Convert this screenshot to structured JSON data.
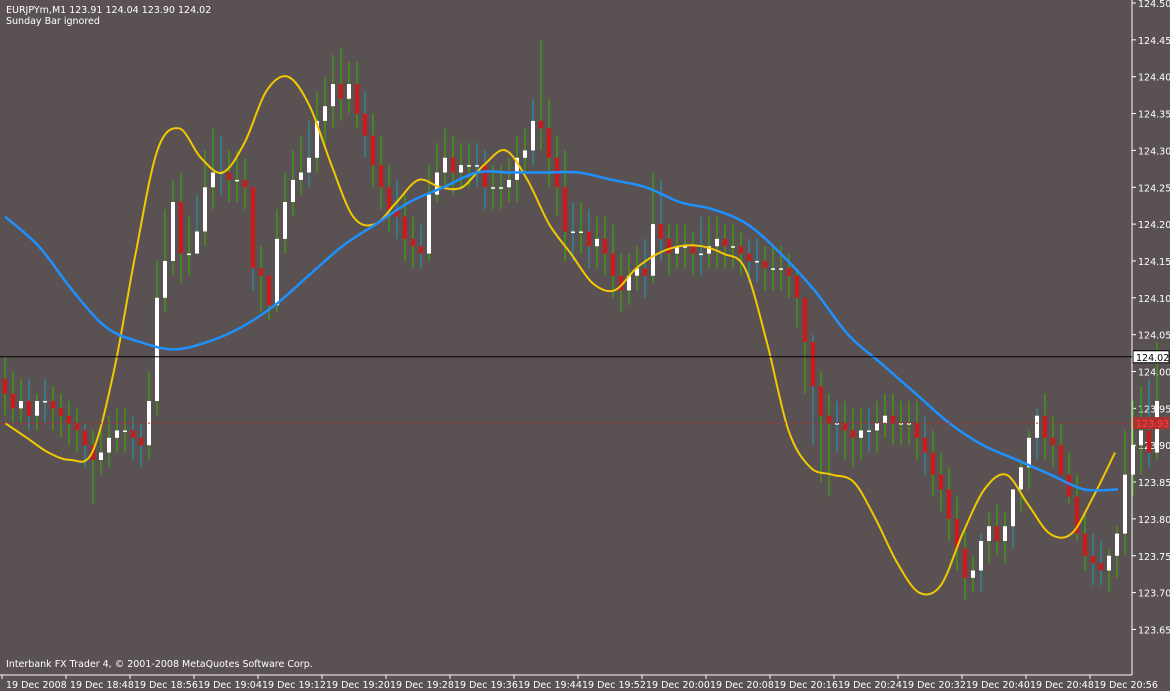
{
  "header": {
    "symbol_line": "EURJPYm,M1  123.91 124.04 123.90 124.02",
    "note": "Sunday Bar ignored"
  },
  "footer": {
    "copyright": "Interbank FX Trader 4, © 2001-2008 MetaQuotes Software Corp."
  },
  "colors": {
    "background": "#5a5252",
    "axis": "#ffffff",
    "bull_candle": "#ffffff",
    "bear_candle": "#d01818",
    "wick": "#34b400",
    "wick_alt": "#1aa0b4",
    "fast_ma": "#f2c800",
    "slow_ma": "#1e90ff",
    "bid_line": "#000000",
    "ask_line": "#b03030"
  },
  "chart_data": {
    "type": "line",
    "title": "EURJPYm,M1",
    "ylim": [
      123.6,
      124.5
    ],
    "yticks": [
      "124.50",
      "124.45",
      "124.40",
      "124.35",
      "124.30",
      "124.25",
      "124.20",
      "124.15",
      "124.10",
      "124.05",
      "124.00",
      "123.95",
      "123.90",
      "123.85",
      "123.80",
      "123.75",
      "123.70",
      "123.65"
    ],
    "xticks": [
      "19 Dec 2008",
      "19 Dec 18:48",
      "19 Dec 18:56",
      "19 Dec 19:04",
      "19 Dec 19:12",
      "19 Dec 19:20",
      "19 Dec 19:28",
      "19 Dec 19:36",
      "19 Dec 19:44",
      "19 Dec 19:52",
      "19 Dec 20:00",
      "19 Dec 20:08",
      "19 Dec 20:16",
      "19 Dec 20:24",
      "19 Dec 20:32",
      "19 Dec 20:40",
      "19 Dec 20:48",
      "19 Dec 20:56"
    ],
    "price_label": "124.02",
    "ask_label": "123.93",
    "bid_level": 124.02,
    "ask_level": 123.93,
    "candles": {
      "open": [
        123.99,
        123.97,
        123.95,
        123.96,
        123.94,
        123.96,
        123.96,
        123.95,
        123.94,
        123.93,
        123.92,
        123.9,
        123.88,
        123.89,
        123.91,
        123.92,
        123.92,
        123.91,
        123.9,
        123.96,
        124.1,
        124.15,
        124.23,
        124.16,
        124.16,
        124.19,
        124.25,
        124.27,
        124.27,
        124.26,
        124.26,
        124.25,
        124.14,
        124.13,
        124.09,
        124.18,
        124.23,
        124.26,
        124.27,
        124.29,
        124.34,
        124.36,
        124.39,
        124.37,
        124.39,
        124.35,
        124.32,
        124.28,
        124.25,
        124.22,
        124.21,
        124.18,
        124.17,
        124.16,
        124.24,
        124.27,
        124.29,
        124.27,
        124.28,
        124.28,
        124.28,
        124.25,
        124.25,
        124.25,
        124.26,
        124.29,
        124.3,
        124.34,
        124.33,
        124.29,
        124.25,
        124.19,
        124.19,
        124.19,
        124.17,
        124.18,
        124.16,
        124.13,
        124.11,
        124.13,
        124.14,
        124.13,
        124.2,
        124.18,
        124.16,
        124.17,
        124.17,
        124.16,
        124.16,
        124.17,
        124.18,
        124.17,
        124.17,
        124.16,
        124.15,
        124.15,
        124.14,
        124.14,
        124.14,
        124.13,
        124.1,
        124.04,
        123.98,
        123.94,
        123.93,
        123.93,
        123.92,
        123.91,
        123.92,
        123.92,
        123.93,
        123.94,
        123.93,
        123.93,
        123.93,
        123.91,
        123.89,
        123.86,
        123.84,
        123.8,
        123.76,
        123.72,
        123.73,
        123.77,
        123.79,
        123.77,
        123.79,
        123.84,
        123.87,
        123.91,
        123.94,
        123.91,
        123.9,
        123.86,
        123.83,
        123.78,
        123.75,
        123.74,
        123.73,
        123.75,
        123.78,
        123.86,
        123.9,
        123.92,
        123.89
      ],
      "close": [
        123.97,
        123.95,
        123.96,
        123.94,
        123.96,
        123.96,
        123.95,
        123.94,
        123.93,
        123.92,
        123.9,
        123.88,
        123.89,
        123.91,
        123.92,
        123.92,
        123.91,
        123.9,
        123.96,
        124.1,
        124.15,
        124.23,
        124.16,
        124.16,
        124.19,
        124.25,
        124.27,
        124.27,
        124.26,
        124.26,
        124.25,
        124.14,
        124.13,
        124.09,
        124.18,
        124.23,
        124.26,
        124.27,
        124.29,
        124.34,
        124.36,
        124.39,
        124.37,
        124.39,
        124.35,
        124.32,
        124.28,
        124.25,
        124.22,
        124.21,
        124.18,
        124.17,
        124.16,
        124.24,
        124.27,
        124.29,
        124.27,
        124.28,
        124.28,
        124.28,
        124.25,
        124.25,
        124.25,
        124.26,
        124.29,
        124.3,
        124.34,
        124.33,
        124.29,
        124.25,
        124.19,
        124.19,
        124.19,
        124.17,
        124.18,
        124.16,
        124.13,
        124.11,
        124.13,
        124.14,
        124.13,
        124.2,
        124.18,
        124.16,
        124.17,
        124.17,
        124.16,
        124.16,
        124.17,
        124.18,
        124.17,
        124.17,
        124.16,
        124.15,
        124.15,
        124.14,
        124.14,
        124.14,
        124.13,
        124.1,
        124.04,
        123.98,
        123.94,
        123.93,
        123.93,
        123.92,
        123.91,
        123.92,
        123.92,
        123.93,
        123.94,
        123.93,
        123.93,
        123.93,
        123.91,
        123.89,
        123.86,
        123.84,
        123.8,
        123.76,
        123.72,
        123.73,
        123.77,
        123.79,
        123.77,
        123.79,
        123.84,
        123.87,
        123.91,
        123.94,
        123.91,
        123.9,
        123.86,
        123.83,
        123.78,
        123.75,
        123.74,
        123.73,
        123.75,
        123.78,
        123.86,
        123.9,
        123.92,
        123.89,
        123.96
      ],
      "high": [
        124.02,
        124.0,
        123.99,
        123.99,
        123.97,
        123.99,
        123.98,
        123.97,
        123.96,
        123.95,
        123.93,
        123.92,
        123.92,
        123.94,
        123.95,
        123.95,
        123.94,
        123.93,
        124.0,
        124.15,
        124.22,
        124.26,
        124.27,
        124.21,
        124.24,
        124.3,
        124.33,
        124.32,
        124.3,
        124.3,
        124.29,
        124.21,
        124.17,
        124.13,
        124.22,
        124.27,
        124.3,
        124.32,
        124.34,
        124.38,
        124.4,
        124.43,
        124.44,
        124.42,
        124.42,
        124.38,
        124.35,
        124.32,
        124.28,
        124.26,
        124.24,
        124.21,
        124.2,
        124.28,
        124.31,
        124.33,
        124.32,
        124.31,
        124.31,
        124.31,
        124.3,
        124.28,
        124.28,
        124.29,
        124.32,
        124.33,
        124.37,
        124.45,
        124.37,
        124.32,
        124.3,
        124.23,
        124.23,
        124.22,
        124.21,
        124.21,
        124.2,
        124.16,
        124.16,
        124.17,
        124.18,
        124.27,
        124.26,
        124.2,
        124.2,
        124.2,
        124.19,
        124.21,
        124.21,
        124.21,
        124.2,
        124.2,
        124.19,
        124.18,
        124.18,
        124.17,
        124.17,
        124.17,
        124.16,
        124.14,
        124.1,
        124.05,
        124.0,
        123.97,
        123.96,
        123.96,
        123.95,
        123.95,
        123.95,
        123.96,
        123.97,
        123.97,
        123.96,
        123.96,
        123.96,
        123.94,
        123.92,
        123.89,
        123.87,
        123.83,
        123.79,
        123.75,
        123.78,
        123.81,
        123.82,
        123.81,
        123.84,
        123.88,
        123.92,
        123.95,
        123.97,
        123.94,
        123.93,
        123.89,
        123.86,
        123.81,
        123.78,
        123.77,
        123.76,
        123.79,
        123.92,
        123.96,
        123.98,
        123.99,
        124.04
      ],
      "low": [
        123.94,
        123.93,
        123.93,
        123.92,
        123.92,
        123.93,
        123.92,
        123.91,
        123.9,
        123.89,
        123.87,
        123.82,
        123.86,
        123.87,
        123.89,
        123.89,
        123.88,
        123.87,
        123.88,
        123.94,
        124.08,
        124.13,
        124.12,
        124.13,
        124.16,
        124.17,
        124.22,
        124.24,
        124.23,
        124.23,
        124.22,
        124.11,
        124.08,
        124.07,
        124.08,
        124.16,
        124.21,
        124.24,
        124.25,
        124.27,
        124.31,
        124.33,
        124.34,
        124.35,
        124.33,
        124.29,
        124.25,
        124.22,
        124.19,
        124.18,
        124.15,
        124.14,
        124.14,
        124.15,
        124.23,
        124.25,
        124.24,
        124.25,
        124.25,
        124.25,
        124.22,
        124.22,
        124.22,
        124.23,
        124.23,
        124.27,
        124.28,
        124.3,
        124.25,
        124.21,
        124.15,
        124.15,
        124.16,
        124.14,
        124.14,
        124.13,
        124.1,
        124.08,
        124.09,
        124.11,
        124.1,
        124.12,
        124.15,
        124.13,
        124.14,
        124.14,
        124.13,
        124.13,
        124.14,
        124.14,
        124.14,
        124.14,
        124.13,
        124.12,
        124.12,
        124.11,
        124.11,
        124.11,
        124.1,
        124.06,
        123.97,
        123.9,
        123.85,
        123.83,
        123.89,
        123.88,
        123.87,
        123.88,
        123.89,
        123.89,
        123.91,
        123.9,
        123.9,
        123.9,
        123.88,
        123.86,
        123.83,
        123.81,
        123.77,
        123.73,
        123.69,
        123.7,
        123.7,
        123.74,
        123.75,
        123.74,
        123.76,
        123.81,
        123.84,
        123.88,
        123.88,
        123.87,
        123.86,
        123.82,
        123.77,
        123.73,
        123.71,
        123.71,
        123.7,
        123.72,
        123.75,
        123.83,
        123.86,
        123.87,
        123.88
      ]
    },
    "series": [
      {
        "color": "#f2c800",
        "values": [
          123.93,
          123.91,
          123.89,
          123.88,
          123.89,
          124.0,
          124.16,
          124.3,
          124.33,
          124.29,
          124.27,
          124.31,
          124.38,
          124.4,
          124.36,
          124.28,
          124.21,
          124.2,
          124.23,
          124.26,
          124.25,
          124.25,
          124.28,
          124.3,
          124.26,
          124.2,
          124.16,
          124.12,
          124.11,
          124.14,
          124.16,
          124.17,
          124.17,
          124.16,
          124.14,
          124.04,
          123.92,
          123.87,
          123.86,
          123.85,
          123.8,
          123.74,
          123.7,
          123.71,
          123.78,
          123.84,
          123.86,
          123.82,
          123.78,
          123.78,
          123.83,
          123.89
        ]
      },
      {
        "color": "#1e90ff",
        "values": [
          124.21,
          124.17,
          124.11,
          124.06,
          124.04,
          124.03,
          124.04,
          124.06,
          124.09,
          124.13,
          124.17,
          124.2,
          124.23,
          124.25,
          124.27,
          124.27,
          124.27,
          124.27,
          124.26,
          124.25,
          124.23,
          124.22,
          124.2,
          124.16,
          124.11,
          124.05,
          124.01,
          123.97,
          123.93,
          123.9,
          123.88,
          123.86,
          123.84,
          123.84
        ]
      }
    ]
  }
}
